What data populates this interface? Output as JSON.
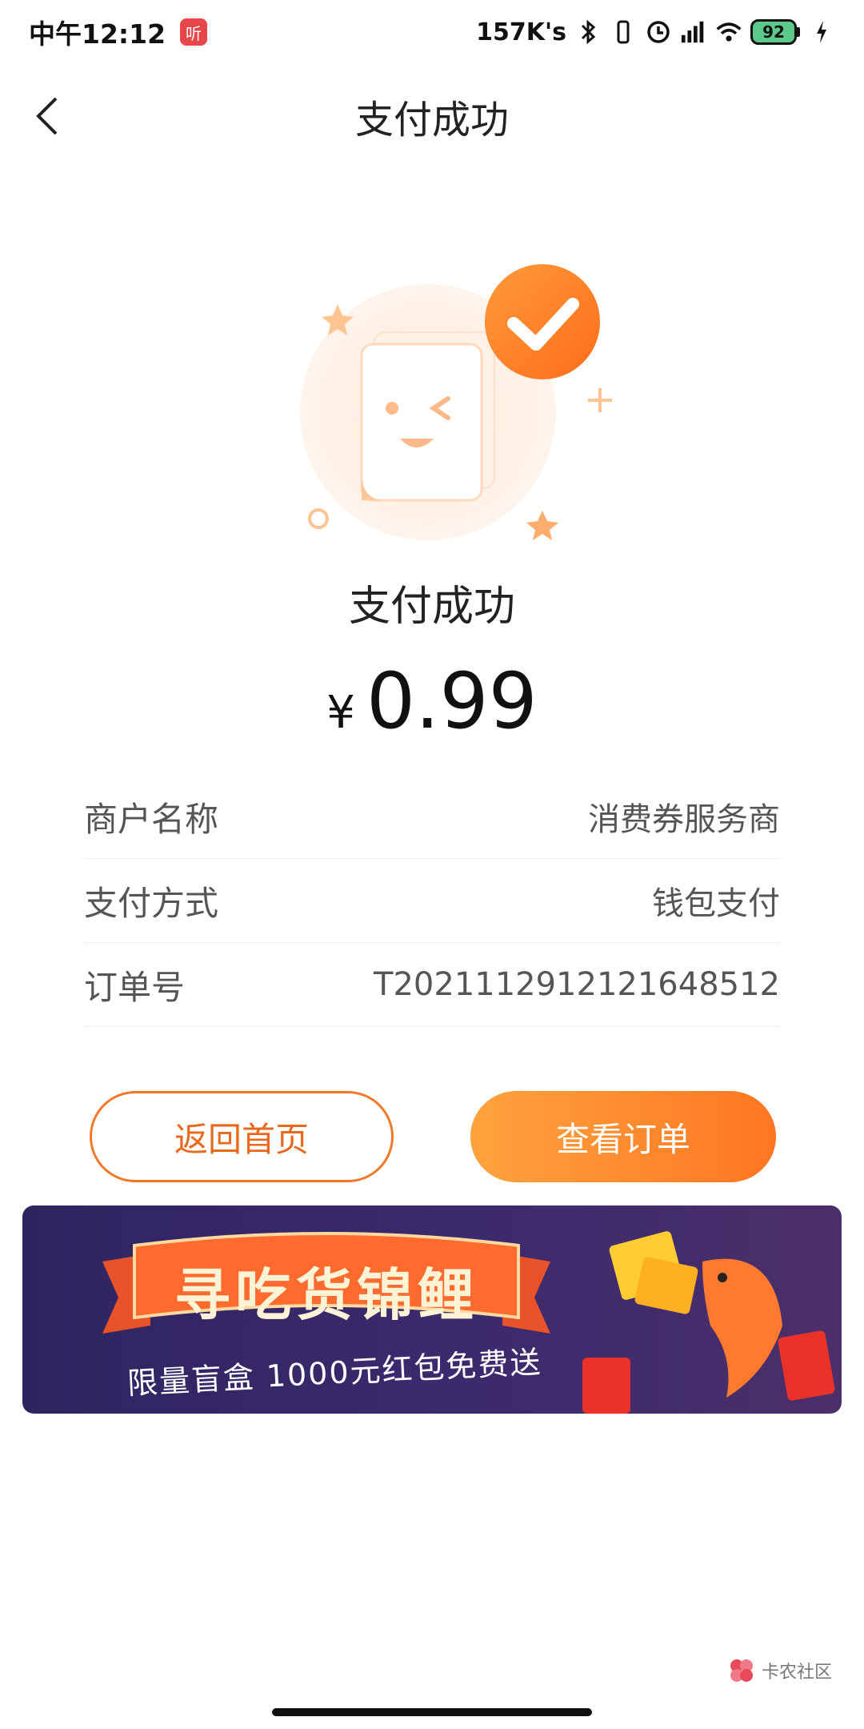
{
  "status_bar": {
    "time": "中午12:12",
    "listen_badge": "听",
    "net_speed": "157K's",
    "battery": "92"
  },
  "nav": {
    "title": "支付成功"
  },
  "result": {
    "title": "支付成功",
    "currency": "¥",
    "amount": "0.99"
  },
  "info": [
    {
      "label": "商户名称",
      "value": "消费券服务商"
    },
    {
      "label": "支付方式",
      "value": "钱包支付"
    },
    {
      "label": "订单号",
      "value": "T2021112912121648512"
    }
  ],
  "buttons": {
    "home": "返回首页",
    "order": "查看订单"
  },
  "banner": {
    "title": "寻吃货锦鲤",
    "subtitle": "限量盲盒 1000元红包免费送"
  },
  "watermark": {
    "text": "卡农社区"
  },
  "colors": {
    "accent": "#ff7622",
    "accent_light": "#ffa33d",
    "banner_bg": "#3c2a6e"
  }
}
